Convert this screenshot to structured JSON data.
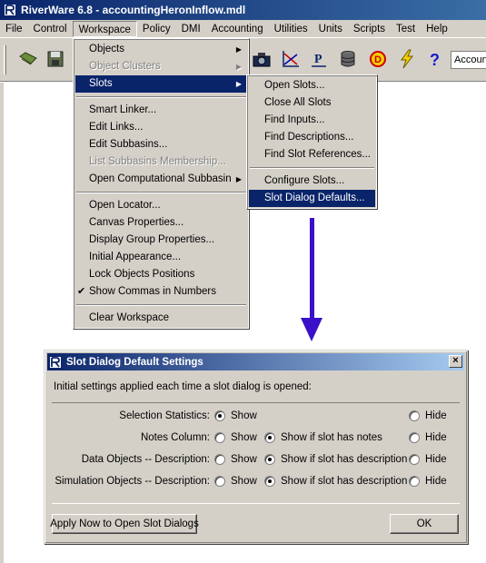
{
  "window": {
    "title": "RiverWare 6.8 - accountingHeronInflow.mdl"
  },
  "menubar": [
    "File",
    "Control",
    "Workspace",
    "Policy",
    "DMI",
    "Accounting",
    "Utilities",
    "Units",
    "Scripts",
    "Test",
    "Help"
  ],
  "toolbar": {
    "account_field": "Accoun",
    "icons": [
      "open-folder-icon",
      "save-disk-icon",
      "camera-icon",
      "plot-chart-icon",
      "policy-p-icon",
      "database-icon",
      "dmi-d-icon",
      "lightning-icon",
      "help-question-icon"
    ]
  },
  "workspace_menu": {
    "items": [
      {
        "label": "Objects",
        "submenu": true
      },
      {
        "label": "Object Clusters",
        "submenu": true,
        "disabled": true
      },
      {
        "label": "Slots",
        "submenu": true,
        "highlighted": true
      },
      {
        "label": "Smart Linker..."
      },
      {
        "label": "Edit Links..."
      },
      {
        "label": "Edit Subbasins..."
      },
      {
        "label": "List Subbasins Membership...",
        "disabled": true
      },
      {
        "label": "Open Computational Subbasin",
        "submenu": true
      },
      {
        "label": "Open Locator..."
      },
      {
        "label": "Canvas Properties..."
      },
      {
        "label": "Display Group Properties..."
      },
      {
        "label": "Initial Appearance..."
      },
      {
        "label": "Lock Objects Positions"
      },
      {
        "label": "Show Commas in Numbers",
        "checked": true
      },
      {
        "label": "Clear Workspace"
      }
    ]
  },
  "slots_menu": {
    "items": [
      {
        "label": "Open Slots..."
      },
      {
        "label": "Close All Slots"
      },
      {
        "label": "Find Inputs..."
      },
      {
        "label": "Find Descriptions..."
      },
      {
        "label": "Find Slot References..."
      },
      {
        "label": "Configure Slots..."
      },
      {
        "label": "Slot Dialog Defaults...",
        "highlighted": true
      }
    ]
  },
  "dialog": {
    "title": "Slot Dialog Default Settings",
    "close_glyph": "×",
    "description": "Initial settings applied each time a slot dialog is opened:",
    "rows": [
      {
        "label": "Selection Statistics:",
        "options": [
          "Show",
          "",
          "Hide"
        ],
        "selected": 0
      },
      {
        "label": "Notes Column:",
        "options": [
          "Show",
          "Show if slot has notes",
          "Hide"
        ],
        "selected": 1
      },
      {
        "label": "Data Objects -- Description:",
        "options": [
          "Show",
          "Show if slot has description",
          "Hide"
        ],
        "selected": 1
      },
      {
        "label": "Simulation Objects -- Description:",
        "options": [
          "Show",
          "Show if slot has description",
          "Hide"
        ],
        "selected": 1
      }
    ],
    "apply_button": "Apply Now to Open Slot Dialogs",
    "ok_button": "OK"
  },
  "colors": {
    "title_bar": "#0a246a",
    "menu_highlight": "#0a246a",
    "face": "#d4d0c8",
    "arrow": "#3a10c8"
  }
}
